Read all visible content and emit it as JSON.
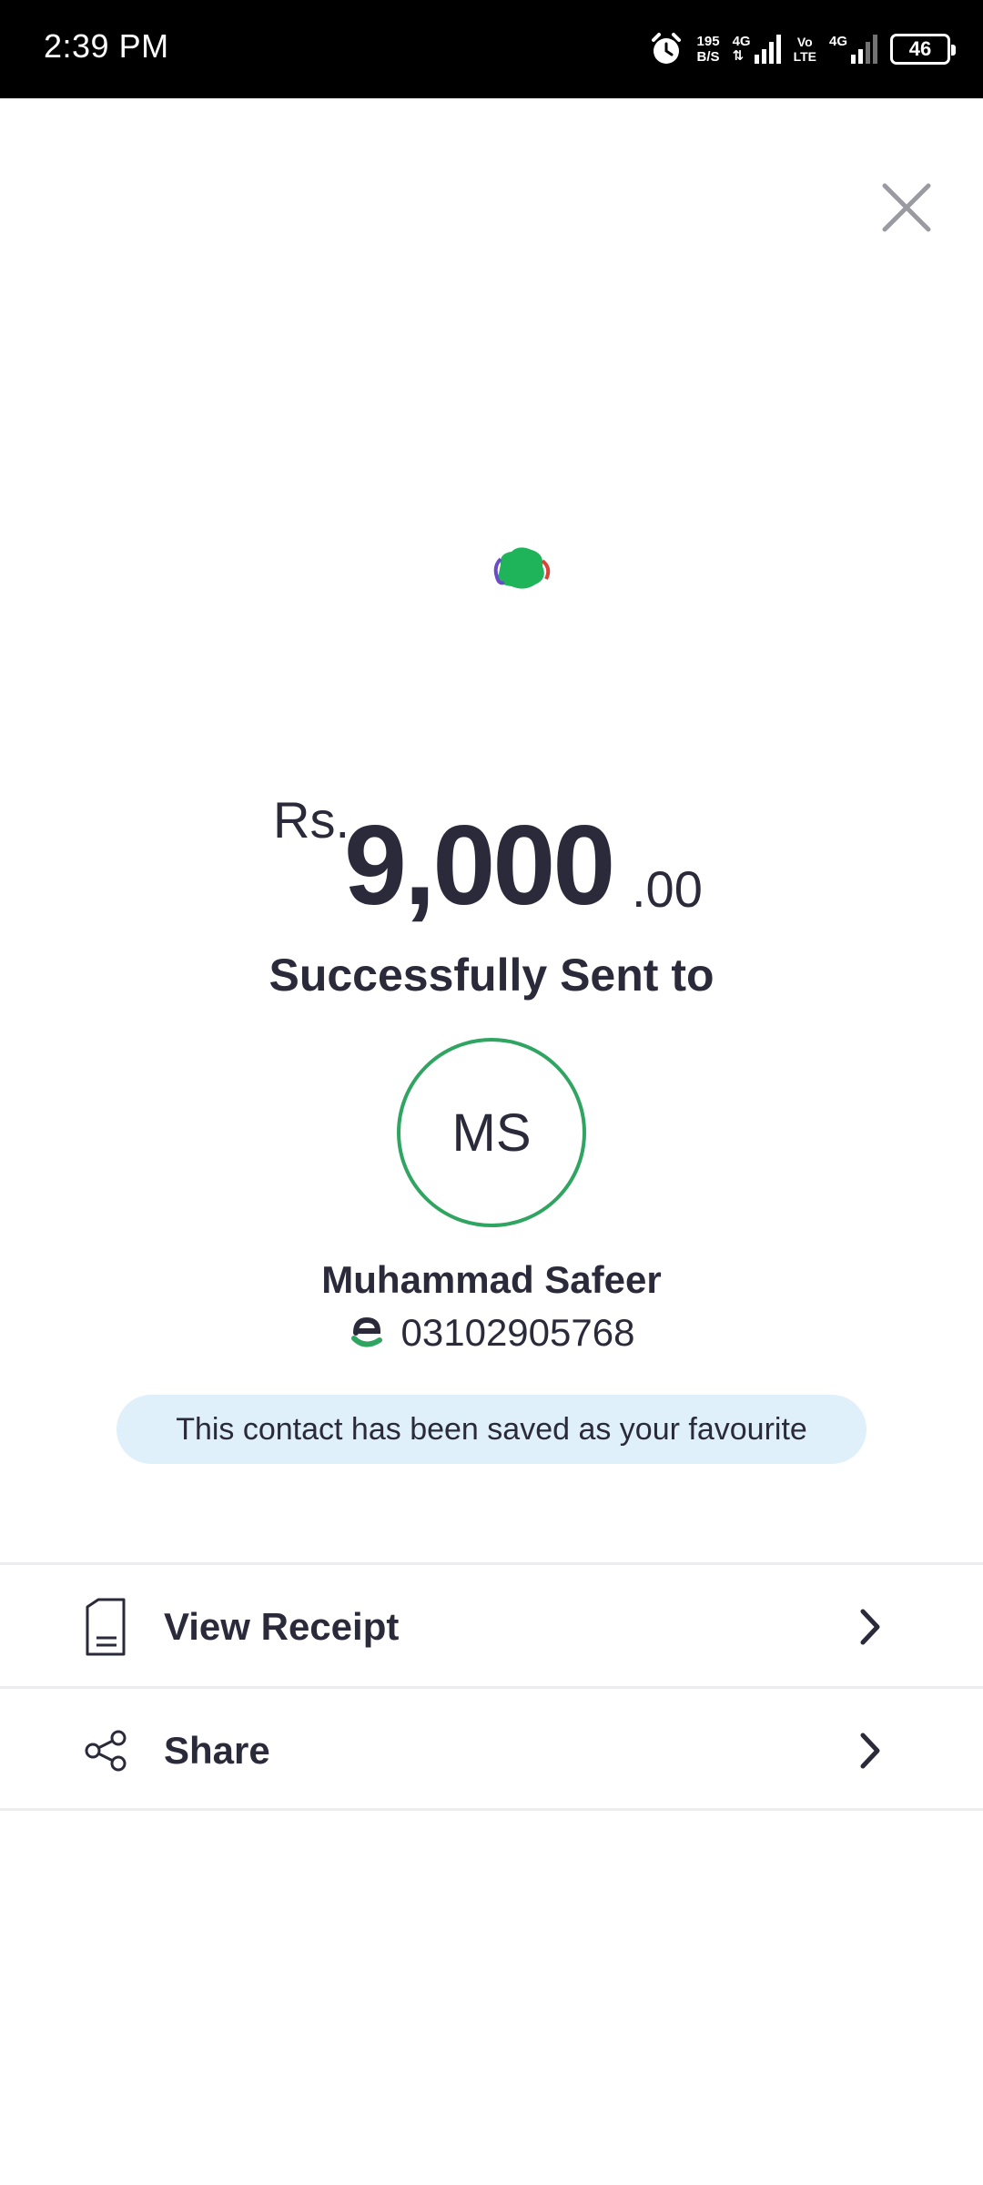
{
  "status_bar": {
    "time": "2:39 PM",
    "net_speed_value": "195",
    "net_speed_unit": "B/S",
    "network_1": "4G",
    "network_2": "4G",
    "volte_top": "Vo",
    "volte_bottom": "LTE",
    "battery_level": "46"
  },
  "close_icon": "close-icon",
  "amount": {
    "currency": "Rs.",
    "whole": "9,000",
    "decimal": ".00"
  },
  "status_message": "Successfully Sent to",
  "recipient": {
    "initials": "MS",
    "name": "Muhammad Safeer",
    "number": "03102905768",
    "avatar_border_color": "#2fa561"
  },
  "favourite_notice": "This contact has been saved as your favourite",
  "actions": [
    {
      "label": "View Receipt",
      "icon": "receipt-icon"
    },
    {
      "label": "Share",
      "icon": "share-icon"
    }
  ],
  "colors": {
    "text": "#2a2a3a",
    "accent_green": "#2fa561",
    "notice_bg": "#dff0fa"
  }
}
